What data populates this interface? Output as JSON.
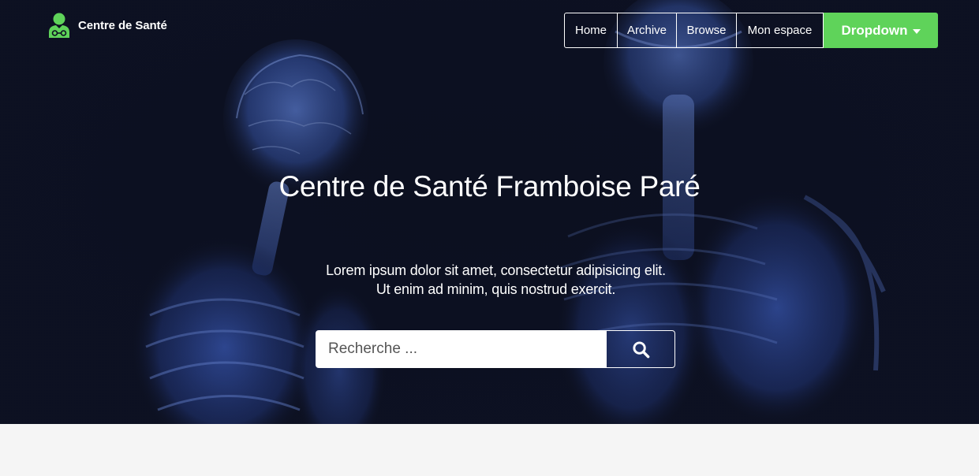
{
  "brand": {
    "name": "Centre de Santé",
    "icon": "doctor-icon"
  },
  "nav": {
    "items": [
      {
        "label": "Home"
      },
      {
        "label": "Archive"
      },
      {
        "label": "Browse"
      },
      {
        "label": "Mon espace"
      }
    ],
    "dropdown_label": "Dropdown"
  },
  "hero": {
    "title": "Centre de Santé Framboise Paré",
    "lead_line1": "Lorem ipsum dolor sit amet, consectetur adipisicing elit.",
    "lead_line2": "Ut enim ad minim, quis nostrud exercit.",
    "background": "anatomy-xray-image"
  },
  "search": {
    "placeholder": "Recherche ...",
    "value": "",
    "button_icon": "search-icon"
  },
  "colors": {
    "accent": "#5fd35a",
    "hero_bg": "#0d1122",
    "page_bg": "#f5f5f5",
    "text_light": "#ffffff"
  }
}
